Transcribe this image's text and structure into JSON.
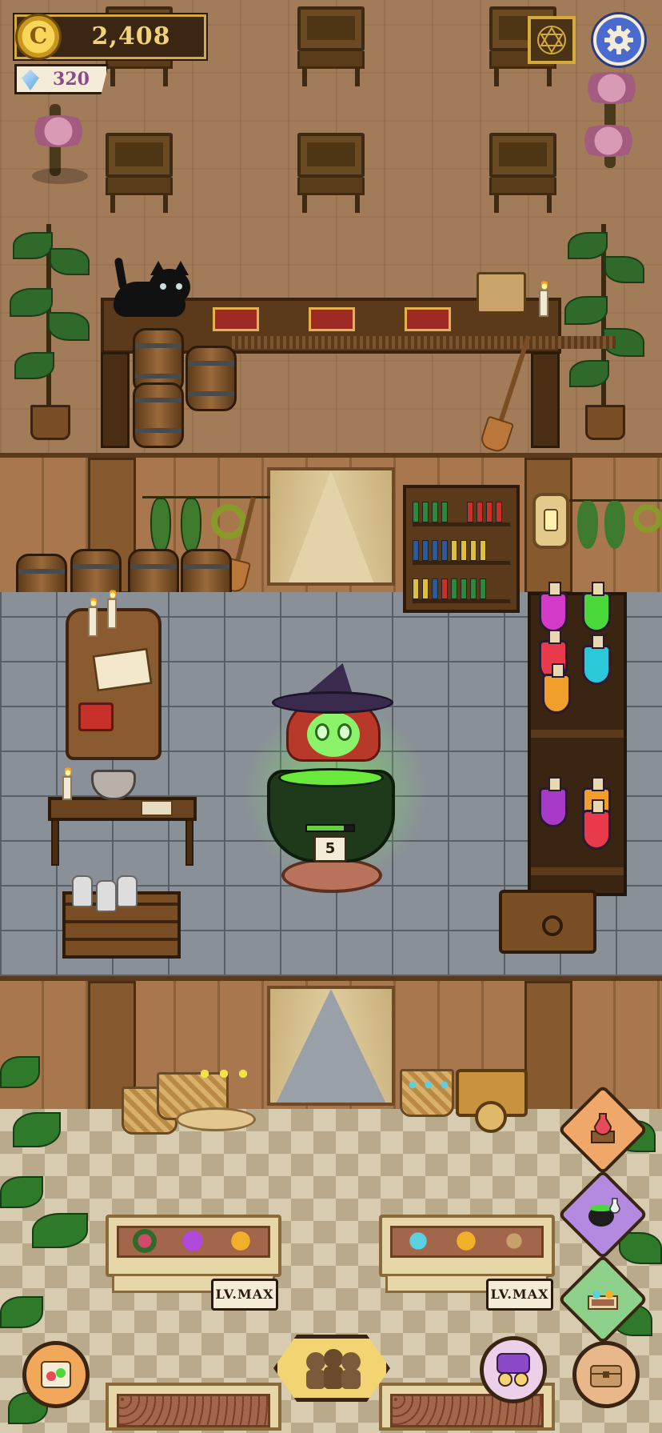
{
  "hud": {
    "coins": "2,408",
    "coin_symbol": "C",
    "gems": "320"
  },
  "cauldron": {
    "brew_count": "5",
    "progress": 0.8
  },
  "garden": {
    "planter_left_level": "LV.MAX",
    "planter_right_level": "LV.MAX"
  },
  "colors": {
    "gold": "#d6a93c",
    "brew_green": "#6be83c",
    "settings_blue": "#4a6ad0"
  },
  "icons": {
    "grimoire": "hexagram-icon",
    "settings": "gear-icon",
    "potion_shop": "potion-shelf-icon",
    "brewing": "cauldron-icon",
    "garden": "garden-plot-icon",
    "recipes": "recipe-scroll-icon",
    "customers": "customers-icon",
    "gacha": "gacha-machine-icon",
    "storage": "chest-icon"
  }
}
